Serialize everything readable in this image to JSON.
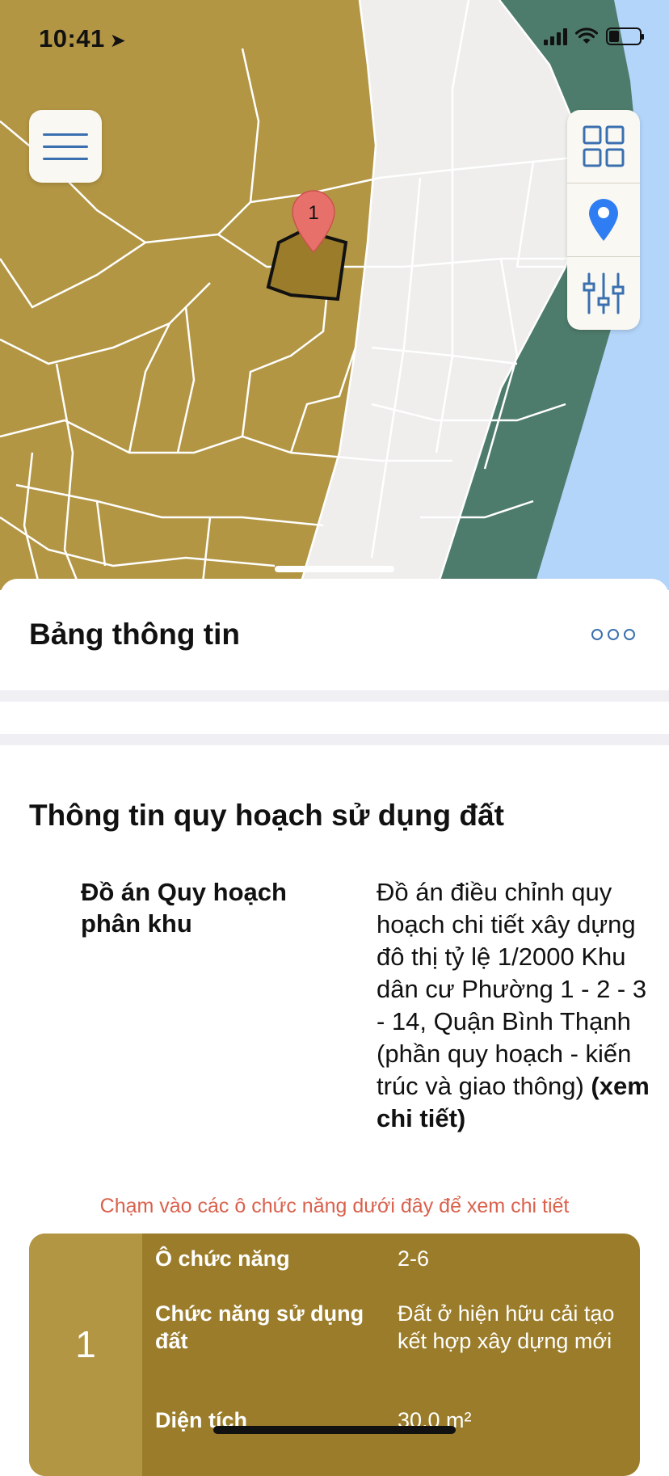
{
  "status": {
    "time": "10:41",
    "location_arrow": "➤"
  },
  "map": {
    "colors": {
      "residential": "#b39644",
      "road": "#efeeed",
      "green": "#4e7c6c",
      "water": "#b3d5fa",
      "selected": "#9a7c2a",
      "marker": "#e8706a"
    },
    "marker_label": "1"
  },
  "toolbar": {
    "menu_icon": "hamburger-icon",
    "grid_icon": "grid-icon",
    "location_icon": "location-pin-icon",
    "filter_icon": "sliders-icon"
  },
  "sheet": {
    "title": "Bảng thông tin",
    "section_title": "Thông tin quy hoạch sử dụng đất",
    "plan_label": "Đồ án Quy hoạch phân khu",
    "plan_value": "Đồ án điều chỉnh quy hoạch chi tiết xây dựng đô thị tỷ lệ 1/2000  Khu dân cư Phường 1 - 2 - 3 - 14, Quận Bình Thạnh (phần quy hoạch - kiến trúc và giao thông)",
    "plan_link": "(xem chi tiết)",
    "hint": "Chạm vào các ô chức năng dưới đây để xem chi tiết"
  },
  "zone": {
    "number": "1",
    "rows": [
      {
        "label": "Ô chức năng",
        "value": "2-6"
      },
      {
        "label": "Chức năng sử dụng đất",
        "value": "Đất ở hiện hữu cải tạo kết hợp xây dựng mới"
      },
      {
        "label": "Diện tích",
        "value": "30,0 m²"
      }
    ]
  }
}
